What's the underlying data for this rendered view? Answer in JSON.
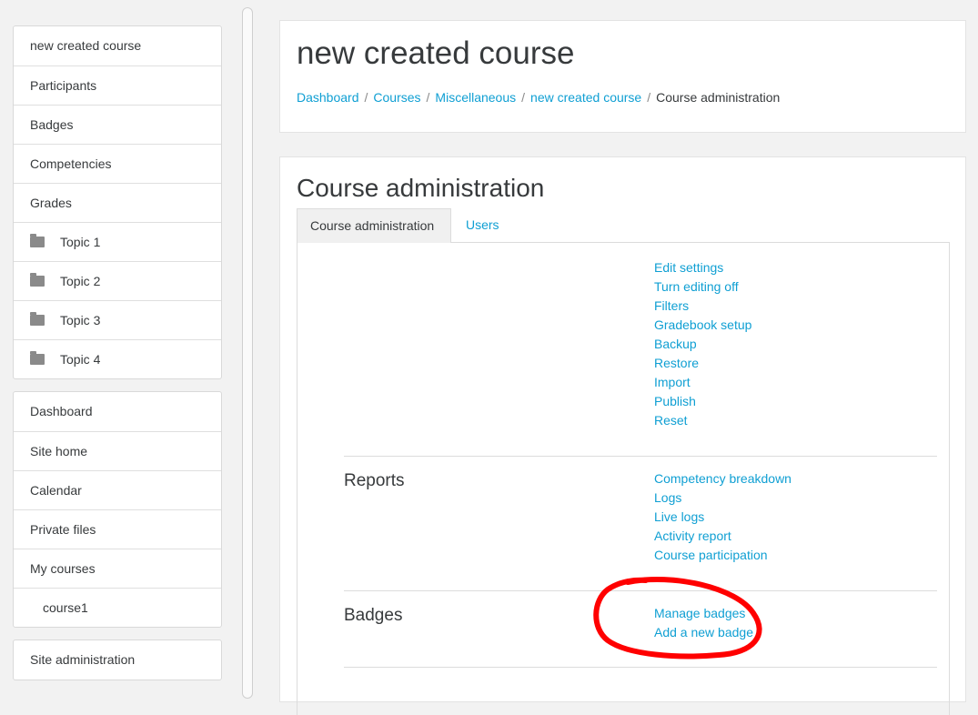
{
  "sidebar": {
    "course_items": [
      {
        "label": "new created course"
      },
      {
        "label": "Participants"
      },
      {
        "label": "Badges"
      },
      {
        "label": "Competencies"
      },
      {
        "label": "Grades"
      },
      {
        "label": "Topic 1",
        "icon": "folder-icon"
      },
      {
        "label": "Topic 2",
        "icon": "folder-icon"
      },
      {
        "label": "Topic 3",
        "icon": "folder-icon"
      },
      {
        "label": "Topic 4",
        "icon": "folder-icon"
      }
    ],
    "site_items": [
      {
        "label": "Dashboard"
      },
      {
        "label": "Site home"
      },
      {
        "label": "Calendar"
      },
      {
        "label": "Private files"
      },
      {
        "label": "My courses"
      },
      {
        "label": "course1"
      }
    ],
    "admin_items": [
      {
        "label": "Site administration"
      }
    ]
  },
  "header": {
    "title": "new created course",
    "breadcrumb": [
      "Dashboard",
      "Courses",
      "Miscellaneous",
      "new created course",
      "Course administration"
    ]
  },
  "main": {
    "title": "Course administration",
    "tabs": [
      {
        "label": "Course administration",
        "active": true
      },
      {
        "label": "Users",
        "active": false
      }
    ],
    "general_links": [
      "Edit settings",
      "Turn editing off",
      "Filters",
      "Gradebook setup",
      "Backup",
      "Restore",
      "Import",
      "Publish",
      "Reset"
    ],
    "reports": {
      "title": "Reports",
      "links": [
        "Competency breakdown",
        "Logs",
        "Live logs",
        "Activity report",
        "Course participation"
      ]
    },
    "badges": {
      "title": "Badges",
      "links": [
        "Manage badges",
        "Add a new badge"
      ]
    }
  },
  "colors": {
    "link": "#0f9fd3",
    "annotation": "#ff0000"
  }
}
